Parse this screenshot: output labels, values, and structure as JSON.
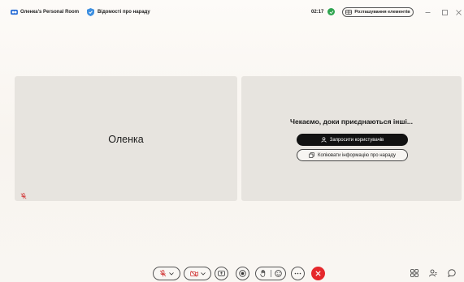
{
  "titlebar": {
    "room_title": "Оленка's Personal Room",
    "meeting_info_label": "Відомості про нараду",
    "timer": "02:17",
    "layout_button_label": "Розташування елементів"
  },
  "tiles": {
    "participant_name": "Оленка",
    "waiting_text": "Чекаємо, доки приєднаються інші...",
    "invite_button_label": "Запросити користувачів",
    "copy_button_label": "Копіювати інформацію про нараду"
  },
  "colors": {
    "leave_button": "#e5282c",
    "status_dot": "#2ea44f",
    "muted_icon": "#d33a3a",
    "invite_button_bg": "#111111"
  }
}
